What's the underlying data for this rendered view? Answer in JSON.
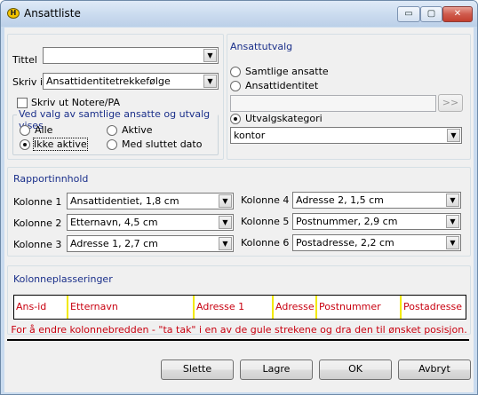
{
  "window": {
    "title": "Ansattliste",
    "app_icon": "H",
    "controls": {
      "minimize": "▭",
      "maximize": "▢",
      "close": "✕"
    }
  },
  "left_panel": {
    "tittel_label": "Tittel",
    "tittel_value": "",
    "skriv_label": "Skriv i",
    "skriv_value": "Ansattidentitetrekkefølge",
    "notes_checkbox_label": "Skriv ut Notere/PA",
    "notes_checked": false,
    "status_group": {
      "legend": "Ved valg av samtlige ansatte og utvalg vises",
      "options": {
        "alle": "Alle",
        "aktive": "Aktive",
        "ikke_aktive": "Ikke aktive",
        "med_sluttet": "Med sluttet dato"
      },
      "selected": "Ikke aktive"
    }
  },
  "selection": {
    "legend": "Ansattutvalg",
    "options": {
      "samtlige": "Samtlige ansatte",
      "ansattidentitet": "Ansattidentitet",
      "utvalgskategori": "Utvalgskategori"
    },
    "selected": "Utvalgskategori",
    "identity_value": "",
    "browse_label": ">>",
    "category_value": "kontor"
  },
  "report": {
    "legend": "Rapportinnhold",
    "columns": [
      {
        "label": "Kolonne 1",
        "value": "Ansattidentiet, 1,8 cm"
      },
      {
        "label": "Kolonne 2",
        "value": "Etternavn, 4,5 cm"
      },
      {
        "label": "Kolonne 3",
        "value": "Adresse 1, 2,7 cm"
      },
      {
        "label": "Kolonne 4",
        "value": "Adresse 2, 1,5 cm"
      },
      {
        "label": "Kolonne 5",
        "value": "Postnummer, 2,9 cm"
      },
      {
        "label": "Kolonne 6",
        "value": "Postadresse, 2,2 cm"
      }
    ]
  },
  "placement": {
    "legend": "Kolonneplasseringer",
    "columns": [
      "Ans-id",
      "Etternavn",
      "Adresse 1",
      "Adresse",
      "Postnummer",
      "Postadresse"
    ],
    "hint": "For å endre kolonnebredden - \"ta tak\" i en av de gule strekene og dra den til ønsket posisjon.",
    "text_color": "#c8000f",
    "divider_color": "#f2ea00"
  },
  "buttons": {
    "delete": "Slette",
    "save": "Lagre",
    "ok": "OK",
    "cancel": "Avbryt"
  },
  "icons": {
    "dropdown": "▼"
  }
}
